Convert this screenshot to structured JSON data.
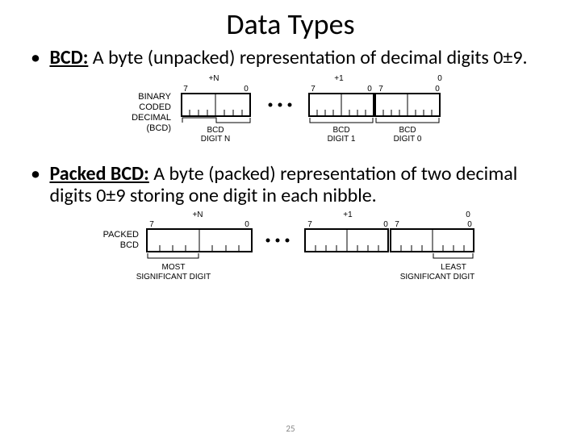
{
  "title": "Data Types",
  "bullet1": {
    "label": "BCD:",
    "text": " A byte (unpacked) representation of decimal digits 0±9."
  },
  "bullet2": {
    "label": "Packed BCD:",
    "text": " A byte (packed) representation of two decimal digits 0±9 storing one digit in each nibble."
  },
  "diagram1": {
    "side_label_l1": "BINARY",
    "side_label_l2": "CODED",
    "side_label_l3": "DECIMAL",
    "side_label_l4": "(BCD)",
    "top_plusN": "+N",
    "top_plus1": "+1",
    "top_zero": "0",
    "bit7": "7",
    "bit0": "0",
    "bcd": "BCD",
    "digitN": "DIGIT N",
    "digit1": "DIGIT 1",
    "digit0": "DIGIT 0"
  },
  "diagram2": {
    "side_label_l1": "PACKED",
    "side_label_l2": "BCD",
    "top_plusN": "+N",
    "top_plus1": "+1",
    "top_zero": "0",
    "bit7": "7",
    "bit0": "0",
    "most": "MOST",
    "least": "LEAST",
    "sigdigit": "SIGNIFICANT DIGIT"
  },
  "page": "25"
}
